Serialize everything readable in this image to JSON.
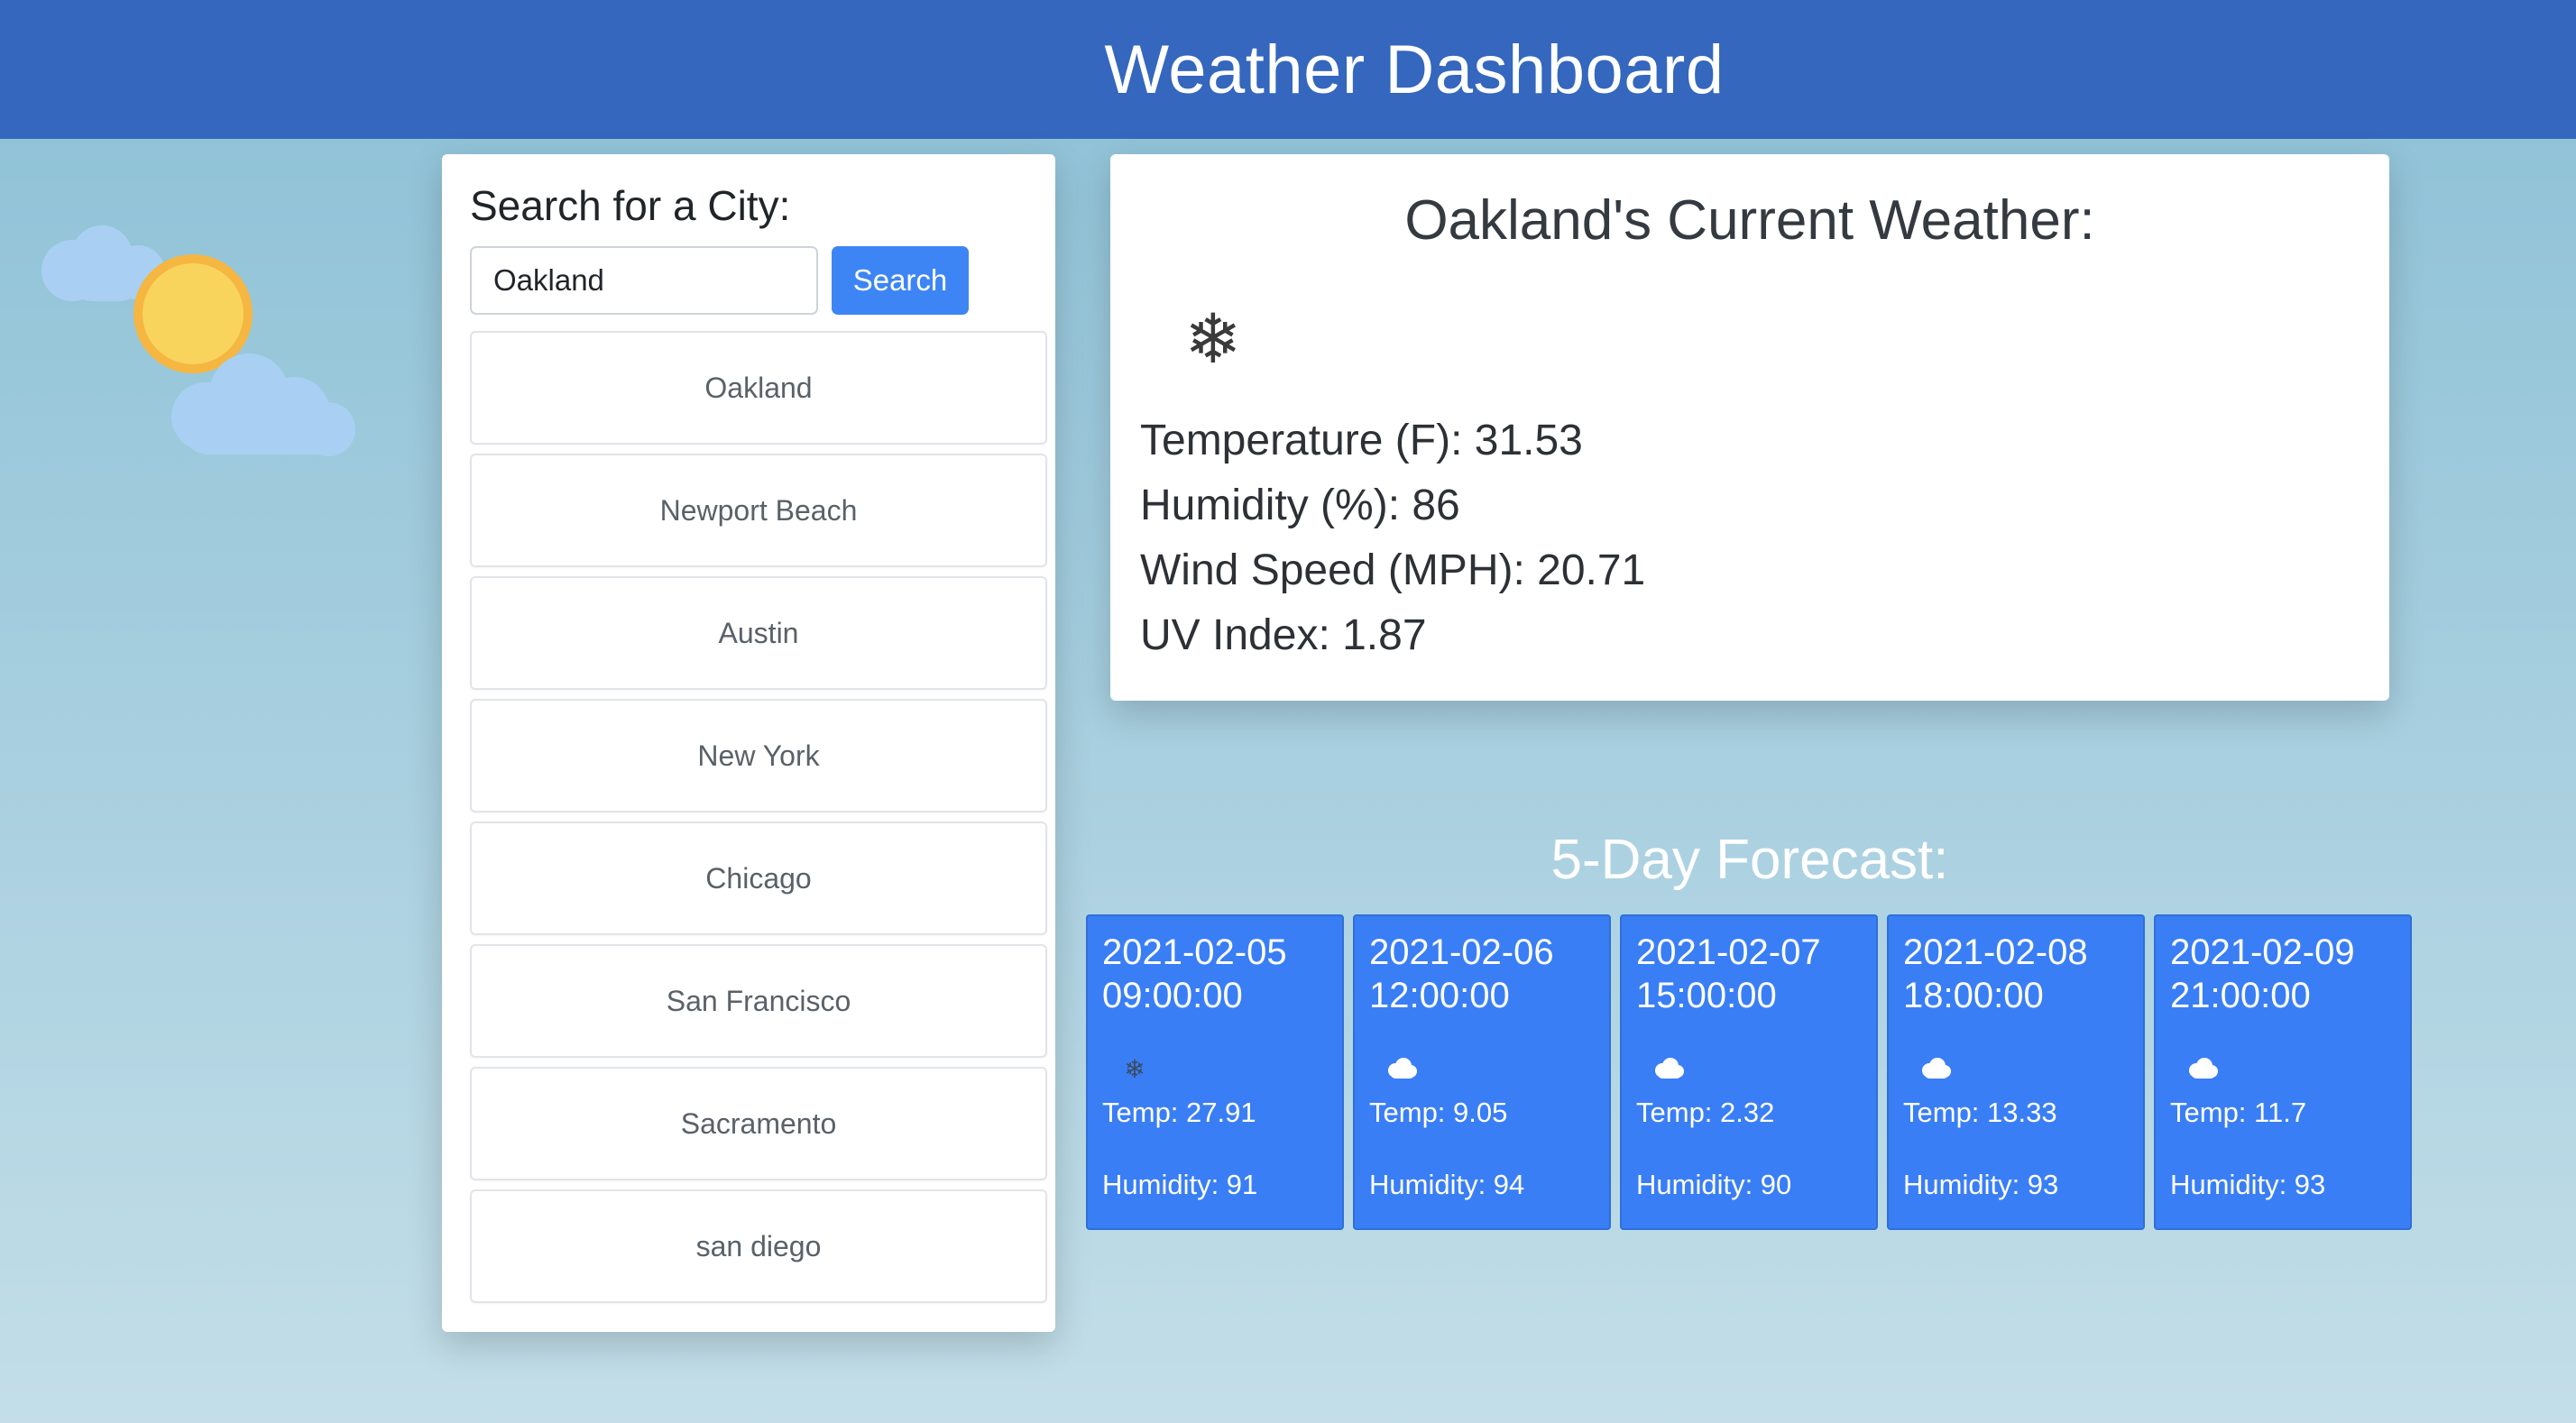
{
  "header": {
    "title": "Weather Dashboard"
  },
  "search": {
    "title": "Search for a City:",
    "input_value": "Oakland",
    "button_label": "Search"
  },
  "history": [
    "Oakland",
    "Newport Beach",
    "Austin",
    "New York",
    "Chicago",
    "San Francisco",
    "Sacramento",
    "san diego"
  ],
  "current": {
    "title": "Oakland's Current Weather:",
    "icon": "snowflake-icon",
    "temperature": "Temperature (F): 31.53",
    "humidity": "Humidity (%): 86",
    "wind": "Wind Speed (MPH): 20.71",
    "uv": "UV Index: 1.87"
  },
  "forecast": {
    "title": "5-Day Forecast:",
    "days": [
      {
        "date": "2021-02-05 09:00:00",
        "icon": "snowflake-icon",
        "temp": "Temp: 27.91",
        "humidity": "Humidity: 91"
      },
      {
        "date": "2021-02-06 12:00:00",
        "icon": "cloud-icon",
        "temp": "Temp: 9.05",
        "humidity": "Humidity: 94"
      },
      {
        "date": "2021-02-07 15:00:00",
        "icon": "cloud-icon",
        "temp": "Temp: 2.32",
        "humidity": "Humidity: 90"
      },
      {
        "date": "2021-02-08 18:00:00",
        "icon": "cloud-icon",
        "temp": "Temp: 13.33",
        "humidity": "Humidity: 93"
      },
      {
        "date": "2021-02-09 21:00:00",
        "icon": "cloud-icon",
        "temp": "Temp: 11.7",
        "humidity": "Humidity: 93"
      }
    ]
  },
  "colors": {
    "header_bg": "#3467bd",
    "primary_button": "#3d85f5",
    "forecast_card": "#3a7ef5"
  }
}
